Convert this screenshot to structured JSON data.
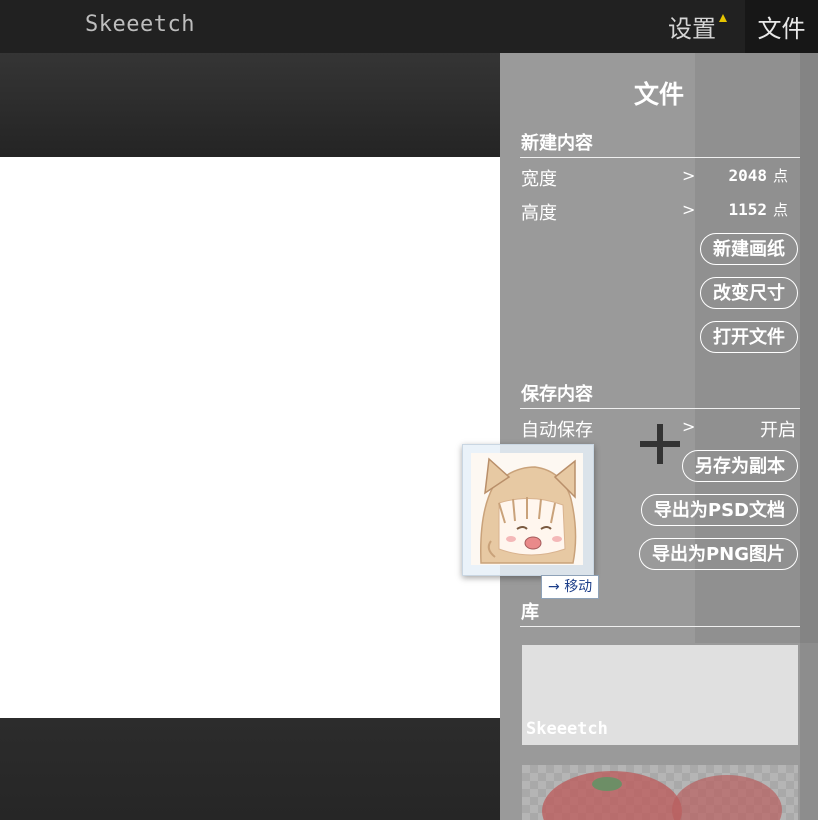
{
  "header": {
    "app_title": "Skeeetch",
    "settings_label": "设置",
    "file_label": "文件"
  },
  "file_panel": {
    "title": "文件",
    "new_section": {
      "title": "新建内容",
      "width_label": "宽度",
      "width_value": "2048",
      "height_label": "高度",
      "height_value": "1152",
      "unit": "点",
      "new_canvas_button": "新建画纸",
      "resize_button": "改变尺寸",
      "open_file_button": "打开文件"
    },
    "save_section": {
      "title": "保存内容",
      "autosave_label": "自动保存",
      "autosave_value": "开启",
      "save_copy_button": "另存为副本",
      "export_psd_button": "导出为PSD文档",
      "export_png_button": "导出为PNG图片"
    },
    "library_section": {
      "title": "库",
      "items": [
        {
          "label": "Skeeetch"
        },
        {
          "label": ""
        }
      ]
    }
  },
  "drag": {
    "tooltip_label": "移动",
    "tooltip_arrow": "→"
  },
  "chevron": ">",
  "colors": {
    "topbar": "#212121",
    "panel": "#9a9a9a",
    "accent_triangle": "#e6c400",
    "canvas": "#ffffff"
  }
}
